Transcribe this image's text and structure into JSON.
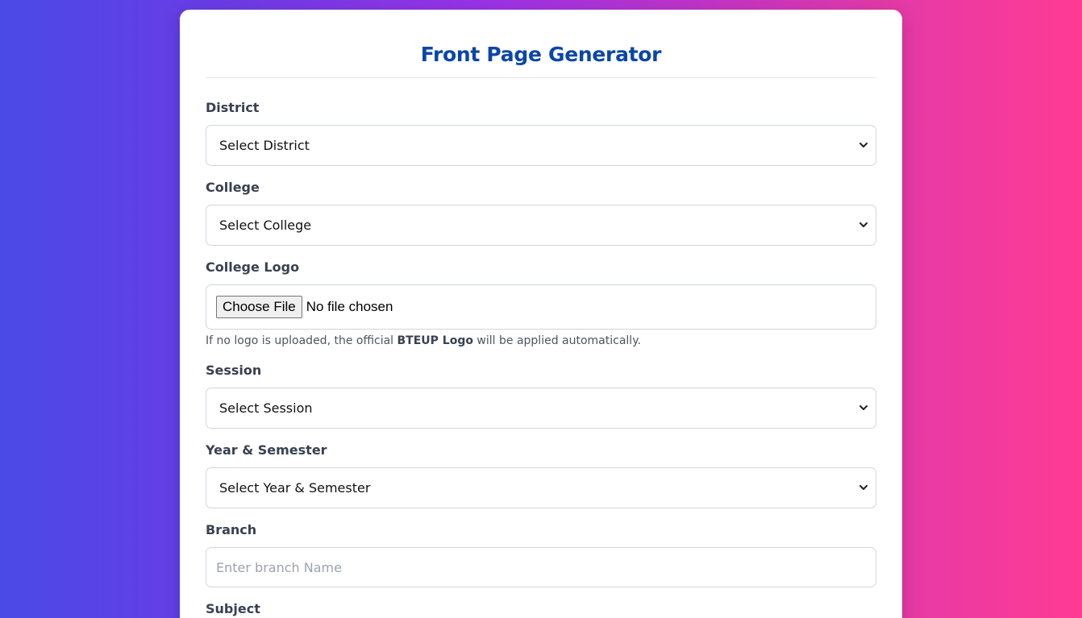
{
  "form": {
    "title": "Front Page Generator",
    "district": {
      "label": "District",
      "value": "Select District"
    },
    "college": {
      "label": "College",
      "value": "Select College"
    },
    "college_logo": {
      "label": "College Logo",
      "button_label": "Choose File",
      "status": "No file chosen",
      "hint_prefix": "If no logo is uploaded, the official ",
      "hint_bold": "BTEUP Logo",
      "hint_suffix": " will be applied automatically."
    },
    "session": {
      "label": "Session",
      "value": "Select Session"
    },
    "year_semester": {
      "label": "Year & Semester",
      "value": "Select Year & Semester"
    },
    "branch": {
      "label": "Branch",
      "placeholder": "Enter branch Name"
    },
    "subject": {
      "label": "Subject"
    }
  },
  "colors": {
    "title": "#0b46a8",
    "label": "#374151",
    "border": "#d1d5db"
  }
}
